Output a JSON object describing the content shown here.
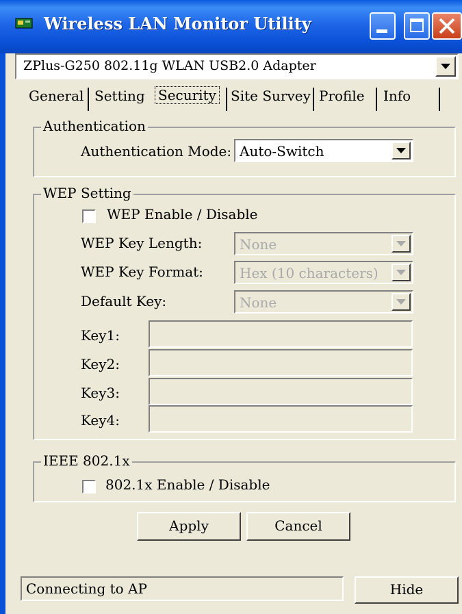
{
  "window": {
    "title": "Wireless LAN Monitor Utility"
  },
  "adapter": {
    "selected": "ZPlus-G250 802.11g WLAN USB2.0 Adapter"
  },
  "tabs": [
    {
      "label": "General"
    },
    {
      "label": "Setting"
    },
    {
      "label": "Security",
      "active": true
    },
    {
      "label": "Site Survey"
    },
    {
      "label": "Profile"
    },
    {
      "label": "Info"
    }
  ],
  "authentication": {
    "group_label": "Authentication",
    "mode_label": "Authentication Mode:",
    "mode_value": "Auto-Switch"
  },
  "wep": {
    "group_label": "WEP Setting",
    "enable_label": "WEP Enable / Disable",
    "enable_checked": false,
    "key_length_label": "WEP Key Length:",
    "key_length_value": "None",
    "key_format_label": "WEP Key Format:",
    "key_format_value": "Hex (10 characters)",
    "default_key_label": "Default Key:",
    "default_key_value": "None",
    "keys": [
      {
        "label": "Key1:",
        "value": ""
      },
      {
        "label": "Key2:",
        "value": ""
      },
      {
        "label": "Key3:",
        "value": ""
      },
      {
        "label": "Key4:",
        "value": ""
      }
    ]
  },
  "ieee": {
    "group_label": "IEEE 802.1x",
    "enable_label": "802.1x Enable / Disable",
    "enable_checked": false
  },
  "buttons": {
    "apply": "Apply",
    "cancel": "Cancel",
    "hide": "Hide"
  },
  "status": {
    "text": "Connecting to AP"
  },
  "colors": {
    "title_bar": "#0a50d6",
    "dialog_bg": "#ece9d8",
    "close_button": "#c9401a"
  }
}
